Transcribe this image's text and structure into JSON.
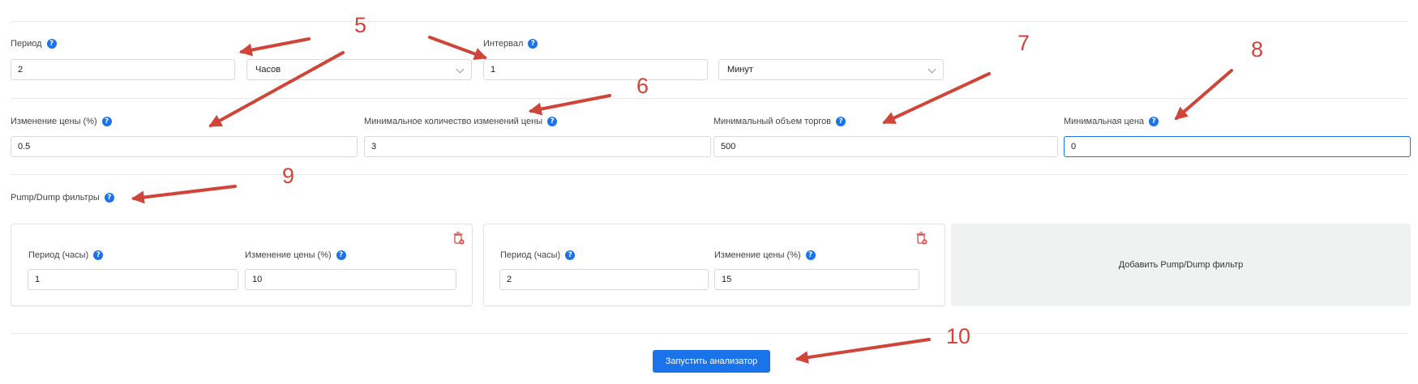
{
  "row1": {
    "period": {
      "label": "Период",
      "value": "2",
      "unit": "Часов"
    },
    "interval": {
      "label": "Интервал",
      "value": "1",
      "unit": "Минут"
    }
  },
  "row2": {
    "price_change": {
      "label": "Изменение цены (%)",
      "value": "0.5"
    },
    "min_changes": {
      "label": "Минимальное количество изменений цены",
      "value": "3"
    },
    "min_volume": {
      "label": "Минимальный объем торгов",
      "value": "500"
    },
    "min_price": {
      "label": "Минимальная цена",
      "value": "0"
    }
  },
  "pump_dump": {
    "title": "Pump/Dump фильтры",
    "filters": [
      {
        "period_label": "Период (часы)",
        "period_value": "1",
        "change_label": "Изменение цены (%)",
        "change_value": "10"
      },
      {
        "period_label": "Период (часы)",
        "period_value": "2",
        "change_label": "Изменение цены (%)",
        "change_value": "15"
      }
    ],
    "add_label": "Добавить Pump/Dump фильтр"
  },
  "run_button": "Запустить анализатор",
  "help_glyph": "?",
  "annotations": {
    "color": "#d0453a",
    "numbers": [
      "5",
      "6",
      "7",
      "8",
      "9",
      "10"
    ]
  },
  "colors": {
    "accent": "#1a73e8",
    "annotation": "#d0453a"
  }
}
